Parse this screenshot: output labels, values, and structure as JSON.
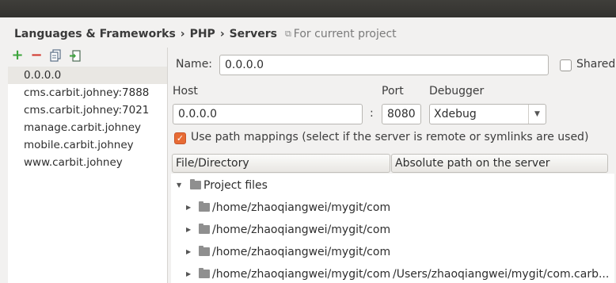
{
  "breadcrumb": {
    "items": [
      "Languages & Frameworks",
      "PHP",
      "Servers"
    ],
    "separator": "›",
    "scope_label": "For current project"
  },
  "toolbar": {
    "add_icon": "plus-icon",
    "remove_icon": "minus-icon",
    "copy_icon": "copy-icon",
    "import_icon": "import-icon"
  },
  "servers": {
    "items": [
      "0.0.0.0",
      "cms.carbit.johney:7888",
      "cms.carbit.johney:7021",
      "manage.carbit.johney",
      "mobile.carbit.johney",
      "www.carbit.johney"
    ],
    "selected_index": 0
  },
  "form": {
    "name_label": "Name:",
    "name_value": "0.0.0.0",
    "shared_label": "Shared",
    "shared_checked": false,
    "host_label": "Host",
    "host_value": "0.0.0.0",
    "port_colon": ":",
    "port_label": "Port",
    "port_value": "8080",
    "debugger_label": "Debugger",
    "debugger_value": "Xdebug",
    "path_mappings_label": "Use path mappings (select if the server is remote or symlinks are used)",
    "path_mappings_checked": true
  },
  "mappings": {
    "columns": [
      "File/Directory",
      "Absolute path on the server"
    ],
    "group_label": "Project files",
    "rows": [
      {
        "file": "/home/zhaoqiangwei/mygit/com",
        "server_path": ""
      },
      {
        "file": "/home/zhaoqiangwei/mygit/com",
        "server_path": ""
      },
      {
        "file": "/home/zhaoqiangwei/mygit/com",
        "server_path": ""
      },
      {
        "file": "/home/zhaoqiangwei/mygit/com",
        "server_path": "/Users/zhaoqiangwei/mygit/com.carb..."
      }
    ]
  },
  "colors": {
    "accent_checkbox": "#e76b34",
    "add_green": "#3da53d",
    "remove_red": "#d2392e",
    "titlebar": "#3a3935"
  }
}
